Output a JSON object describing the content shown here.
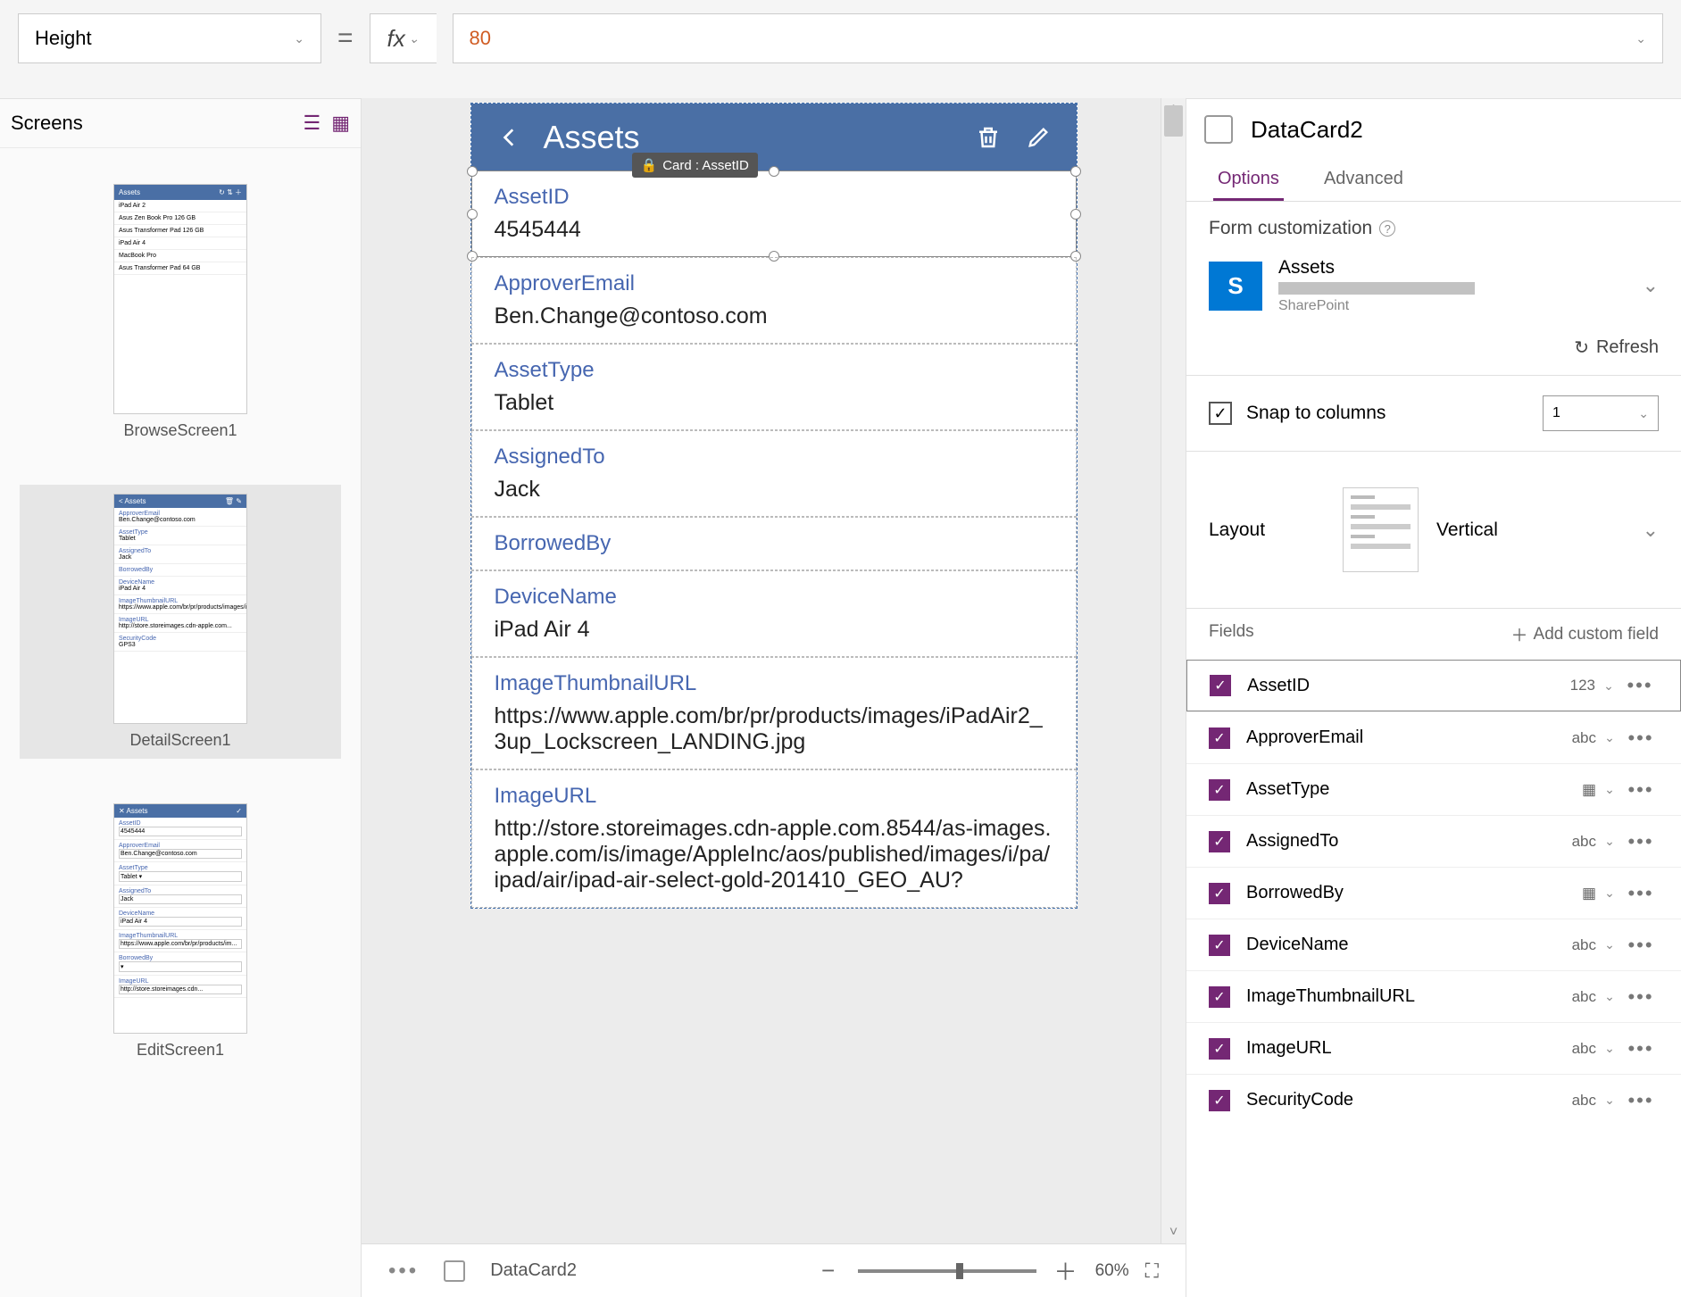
{
  "formula": {
    "property": "Height",
    "value": "80"
  },
  "screensPanel": {
    "title": "Screens",
    "items": [
      {
        "label": "BrowseScreen1",
        "selected": false
      },
      {
        "label": "DetailScreen1",
        "selected": true
      },
      {
        "label": "EditScreen1",
        "selected": false
      }
    ]
  },
  "tooltip": "Card : AssetID",
  "app": {
    "title": "Assets",
    "cards": [
      {
        "label": "AssetID",
        "value": "4545444",
        "selected": true
      },
      {
        "label": "ApproverEmail",
        "value": "Ben.Change@contoso.com"
      },
      {
        "label": "AssetType",
        "value": "Tablet"
      },
      {
        "label": "AssignedTo",
        "value": "Jack"
      },
      {
        "label": "BorrowedBy",
        "value": ""
      },
      {
        "label": "DeviceName",
        "value": "iPad Air 4"
      },
      {
        "label": "ImageThumbnailURL",
        "value": "https://www.apple.com/br/pr/products/images/iPadAir2_3up_Lockscreen_LANDING.jpg"
      },
      {
        "label": "ImageURL",
        "value": "http://store.storeimages.cdn-apple.com.8544/as-images.apple.com/is/image/AppleInc/aos/published/images/i/pa/ipad/air/ipad-air-select-gold-201410_GEO_AU?"
      }
    ]
  },
  "rightPanel": {
    "title": "DataCard2",
    "tabs": {
      "options": "Options",
      "advanced": "Advanced"
    },
    "formCust": "Form customization",
    "dataSource": {
      "name": "Assets",
      "provider": "SharePoint"
    },
    "refresh": "Refresh",
    "snapLabel": "Snap to columns",
    "snapValue": "1",
    "layoutLabel": "Layout",
    "layoutValue": "Vertical",
    "fieldsLabel": "Fields",
    "addCustom": "Add custom field",
    "fields": [
      {
        "name": "AssetID",
        "type": "123",
        "selected": true
      },
      {
        "name": "ApproverEmail",
        "type": "abc"
      },
      {
        "name": "AssetType",
        "type": "grid"
      },
      {
        "name": "AssignedTo",
        "type": "abc"
      },
      {
        "name": "BorrowedBy",
        "type": "grid"
      },
      {
        "name": "DeviceName",
        "type": "abc"
      },
      {
        "name": "ImageThumbnailURL",
        "type": "abc"
      },
      {
        "name": "ImageURL",
        "type": "abc"
      },
      {
        "name": "SecurityCode",
        "type": "abc"
      }
    ]
  },
  "statusBar": {
    "label": "DataCard2",
    "zoom": "60%"
  }
}
